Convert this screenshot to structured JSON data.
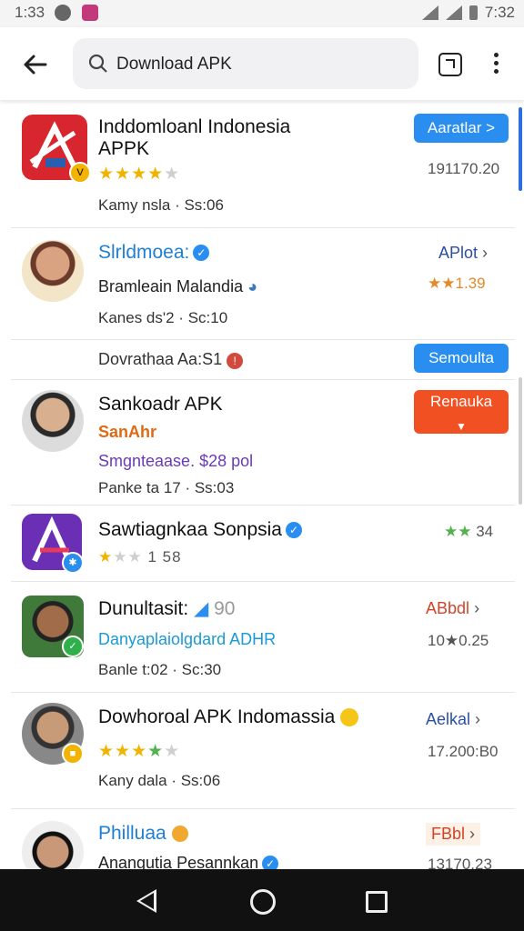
{
  "statusbar": {
    "time": "1:33",
    "right": "7:32"
  },
  "search": {
    "query": "Download APK"
  },
  "items": [
    {
      "title_line1": "Inddomloanl Indonesia",
      "title_line2": "APPK",
      "meta": "Kamy nsla · Ss:06",
      "button": "Aaratlar >",
      "number": "191170.20"
    },
    {
      "title": "Slrldmoea:",
      "sub": "Bramleain Malandia",
      "meta": "Kanes ds'2 · Sc:10",
      "link": "APlot",
      "rating": "1.39"
    },
    {
      "text": "Dovrathaa Aa:S1",
      "button": "Semoulta"
    },
    {
      "title": "Sankoadr APK",
      "tag": "SanAhr",
      "sub": "Smgnteaase. $28 pol",
      "meta": "Panke ta 17 · Ss:03",
      "button": "Renauka"
    },
    {
      "title": "Sawtiagnkaa Sonpsia",
      "rating": "1 58",
      "right_rating": "34"
    },
    {
      "title": "Dunultasit:",
      "title_suffix": "90",
      "sub": "Danyaplaiolgdard ADHR",
      "meta": "Banle t:02 · Sc:30",
      "link": "ABbdl",
      "number": "10★0.25"
    },
    {
      "title": "Dowhoroal APK Indomassia",
      "meta": "Kany dala · Ss:06",
      "link": "Aelkal",
      "number": "17.200:B0"
    },
    {
      "title": "Philluaa",
      "sub": "Anangutia Pesannkan",
      "link": "FBbl",
      "number": "13170.23"
    }
  ]
}
